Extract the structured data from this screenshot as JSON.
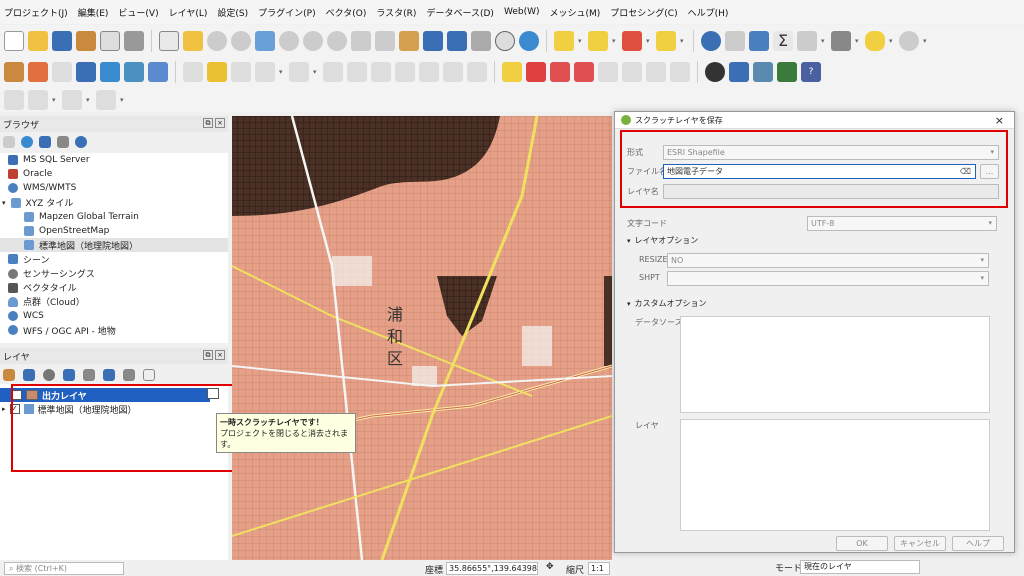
{
  "menu": [
    "プロジェクト(J)",
    "編集(E)",
    "ビュー(V)",
    "レイヤ(L)",
    "設定(S)",
    "プラグイン(P)",
    "ベクタ(O)",
    "ラスタ(R)",
    "データベース(D)",
    "Web(W)",
    "メッシュ(M)",
    "プロセシング(C)",
    "ヘルプ(H)"
  ],
  "browser": {
    "title": "ブラウザ",
    "items": [
      "MS SQL Server",
      "Oracle",
      "WMS/WMTS",
      "XYZ タイル",
      "Mapzen Global Terrain",
      "OpenStreetMap",
      "標準地図（地理院地図）",
      "シーン",
      "センサーシングス",
      "ベクタタイル",
      "点群（Cloud）",
      "WCS",
      "WFS / OGC API - 地物"
    ]
  },
  "layers": {
    "title": "レイヤ",
    "items": [
      "出力レイヤ",
      "標準地図（地理院地図）"
    ],
    "tooltip_title": "一時スクラッチレイヤです！",
    "tooltip_body": "プロジェクトを閉じると消去されます。"
  },
  "map": {
    "ward_label": "浦和区"
  },
  "dialog": {
    "title": "スクラッチレイヤを保存",
    "format_label": "形式",
    "format_value": "ESRI Shapefile",
    "file_label": "ファイル名",
    "file_value": "地図電子データ",
    "layer_label": "レイヤ名",
    "encoding_label": "文字コード",
    "encoding_value": "UTF-8",
    "layer_options": "レイヤオプション",
    "resize_label": "RESIZE",
    "resize_value": "NO",
    "shpt_label": "SHPT",
    "custom_options": "カスタムオプション",
    "datasource_label": "データソース",
    "layer2_label": "レイヤ",
    "ok": "OK",
    "cancel": "キャンセル",
    "help": "ヘルプ",
    "browse": "..."
  },
  "status": {
    "search_placeholder": "検索 (Ctrl+K)",
    "coord_label": "座標",
    "coord_value": "35.86655°,139.64398°",
    "scale_label": "縮尺",
    "scale_value": "1:1",
    "mode_label": "モード",
    "mode_value": "現在のレイヤ"
  },
  "colors": {
    "accent": "#2060c0",
    "highlight": "#e00000",
    "map_base": "#e6a087"
  }
}
